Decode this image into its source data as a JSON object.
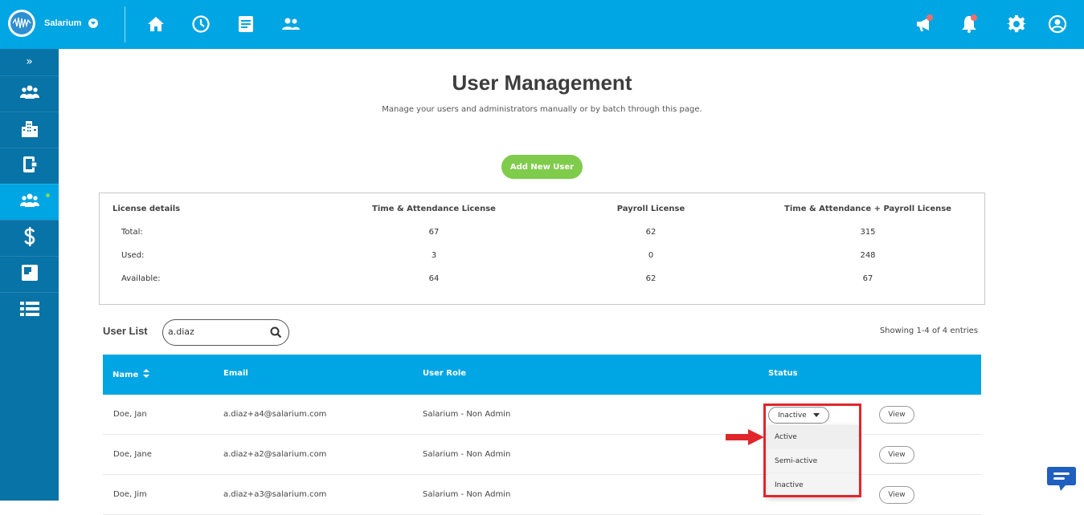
{
  "app": {
    "brand_name": "Salarium"
  },
  "topnav": {
    "items": [
      "home-icon",
      "clock-icon",
      "document-icon",
      "people-icon"
    ],
    "right": [
      "megaphone-icon",
      "bell-icon",
      "gear-icon",
      "account-icon"
    ]
  },
  "sidebar": {
    "expand_label": "»",
    "items": [
      "people-icon",
      "building-icon",
      "device-icon",
      "users-icon",
      "dollar-icon",
      "squares-icon",
      "list-icon"
    ],
    "active_index": 3
  },
  "page": {
    "title": "User Management",
    "subtitle": "Manage your users and administrators manually or by batch through this page.",
    "add_button": "Add New User"
  },
  "license": {
    "header_label": "License details",
    "columns": [
      "Time & Attendance License",
      "Payroll License",
      "Time & Attendance + Payroll License"
    ],
    "rows": [
      {
        "label": "Total:",
        "values": [
          "67",
          "62",
          "315"
        ]
      },
      {
        "label": "Used:",
        "values": [
          "3",
          "0",
          "248"
        ]
      },
      {
        "label": "Available:",
        "values": [
          "64",
          "62",
          "67"
        ]
      }
    ]
  },
  "userlist": {
    "label": "User List",
    "search_value": "a.diaz",
    "entries": "Showing 1-4 of 4 entries"
  },
  "table": {
    "headers": {
      "name": "Name",
      "email": "Email",
      "role": "User Role",
      "status": "Status"
    },
    "sort_icon": "sort-icon",
    "rows": [
      {
        "name": "Doe, Jan",
        "email": "a.diaz+a4@salarium.com",
        "role": "Salarium - Non Admin",
        "status": "Inactive",
        "view": "View"
      },
      {
        "name": "Doe, Jane",
        "email": "a.diaz+a2@salarium.com",
        "role": "Salarium - Non Admin",
        "status": "",
        "view": "View"
      },
      {
        "name": "Doe, Jim",
        "email": "a.diaz+a3@salarium.com",
        "role": "Salarium - Non Admin",
        "status": "",
        "view": "View"
      }
    ]
  },
  "status_dropdown": {
    "options": [
      "Active",
      "Semi-active",
      "Inactive"
    ]
  },
  "colors": {
    "primary": "#00a5e3",
    "sidebar": "#0773a6",
    "add_button": "#7fcb4b",
    "highlight": "#e0262b",
    "chat": "#1e5fbf"
  }
}
